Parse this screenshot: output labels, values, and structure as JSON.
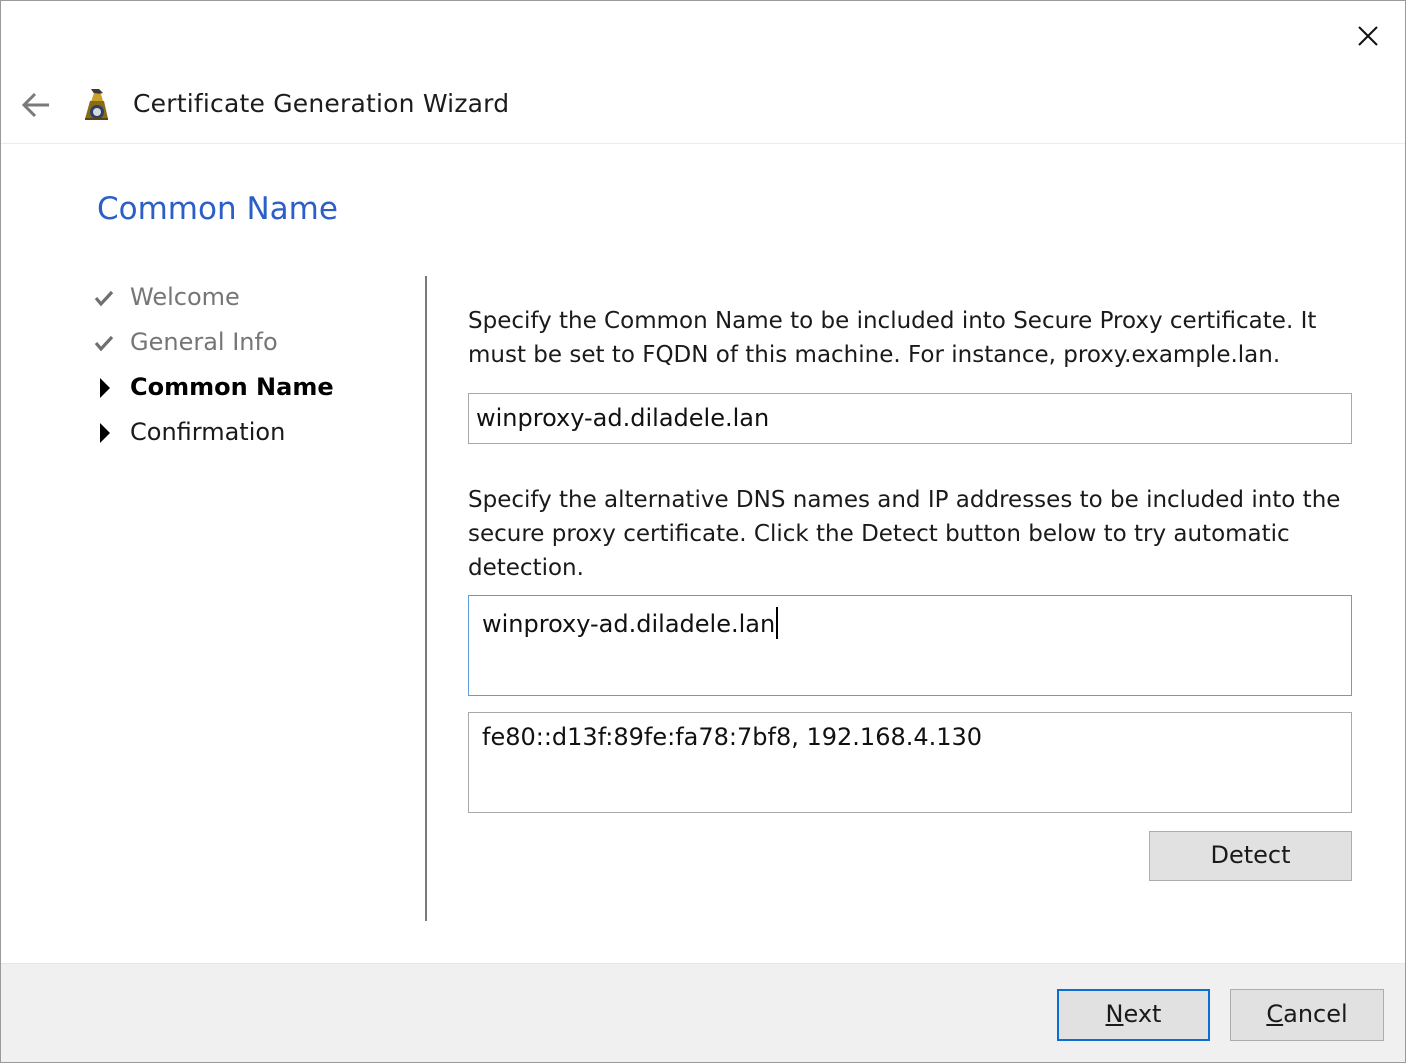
{
  "window": {
    "title": "Certificate Generation Wizard",
    "icons": {
      "close": "close-icon",
      "back": "back-arrow-icon",
      "app": "app-icon"
    }
  },
  "page": {
    "title": "Common Name"
  },
  "steps": [
    {
      "label": "Welcome",
      "state": "done",
      "icon": "checkmark-icon"
    },
    {
      "label": "General Info",
      "state": "done",
      "icon": "checkmark-icon"
    },
    {
      "label": "Common Name",
      "state": "current",
      "icon": "triangle-right-icon"
    },
    {
      "label": "Confirmation",
      "state": "pending",
      "icon": "triangle-right-icon"
    }
  ],
  "form": {
    "common_name_desc": "Specify the Common Name to be included into Secure Proxy certificate. It must be set to FQDN of this machine. For instance, proxy.example.lan.",
    "common_name_value": "winproxy-ad.diladele.lan",
    "alt_names_desc": "Specify the alternative DNS names and IP addresses to be included into the secure proxy certificate. Click the Detect button below to try automatic detection.",
    "dns_names_value": "winproxy-ad.diladele.lan",
    "ip_addresses_value": "fe80::d13f:89fe:fa78:7bf8, 192.168.4.130",
    "detect_label": "Detect"
  },
  "footer": {
    "next_mnemonic": "N",
    "next_rest": "ext",
    "cancel_mnemonic": "C",
    "cancel_rest": "ancel"
  },
  "colors": {
    "accent": "#2b5fc7",
    "focus_border": "#0a6fd4",
    "footer_bg": "#f0f0f0"
  }
}
